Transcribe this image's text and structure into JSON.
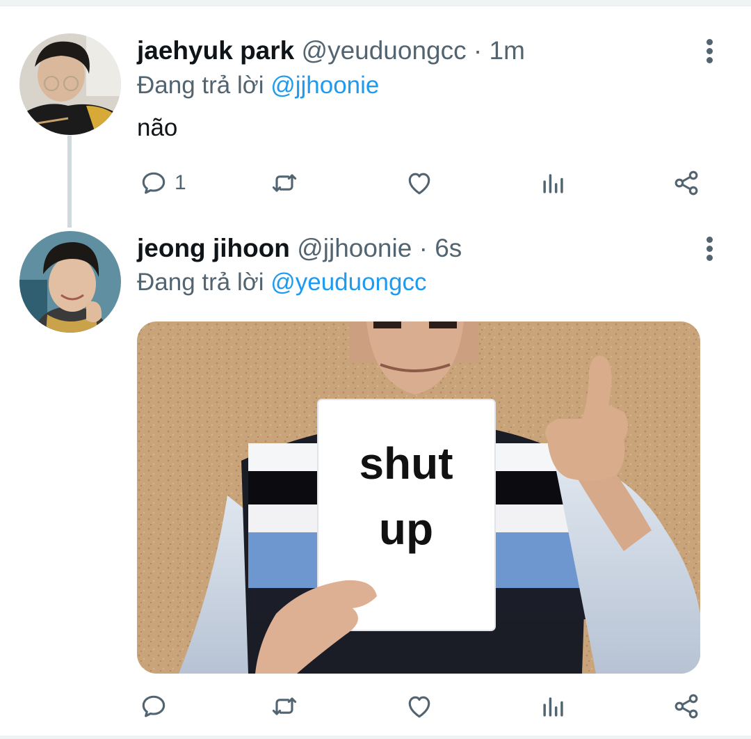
{
  "tweets": [
    {
      "name": "jaehyuk park",
      "handle": "@yeuduongcc",
      "separator": "·",
      "time": "1m",
      "reply_prefix": "Đang trả lời",
      "reply_to": "@jjhoonie",
      "text": "não",
      "reply_count": "1"
    },
    {
      "name": "jeong jihoon",
      "handle": "@jjhoonie",
      "separator": "·",
      "time": "6s",
      "reply_prefix": "Đang trả lời",
      "reply_to": "@yeuduongcc",
      "media": {
        "sign_line1": "shut",
        "sign_line2": "up"
      }
    }
  ],
  "colors": {
    "accent": "#1d9bf0",
    "secondary_text": "#536471",
    "primary_text": "#0f1419"
  },
  "icons": [
    "reply-icon",
    "retweet-icon",
    "like-icon",
    "analytics-icon",
    "share-icon",
    "more-options-icon"
  ]
}
